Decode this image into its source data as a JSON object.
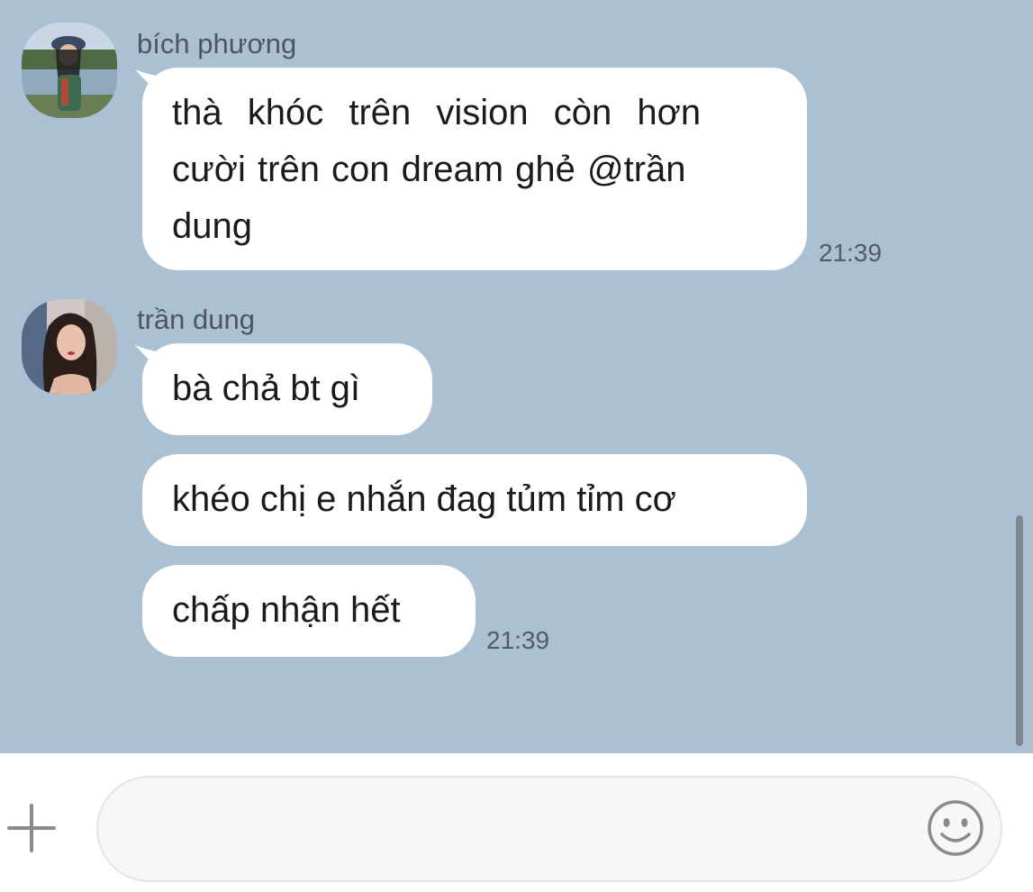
{
  "messages": [
    {
      "sender": "bích phương",
      "avatar": "avatar-bich-phuong",
      "bubbles": [
        {
          "lines": [
            "thà khóc trên vision còn hơn",
            "cười trên con dream ghẻ @trần",
            "dung"
          ]
        }
      ],
      "time": "21:39"
    },
    {
      "sender": "trần dung",
      "avatar": "avatar-tran-dung",
      "bubbles": [
        {
          "text": "bà chả bt gì"
        },
        {
          "text": "khéo chị e nhắn đag tủm tỉm cơ"
        },
        {
          "text": "chấp nhận hết"
        }
      ],
      "time": "21:39"
    }
  ],
  "composer": {
    "add_icon": "plus-icon",
    "emoji_icon": "smiley-icon",
    "placeholder": ""
  },
  "colors": {
    "chat_background": "#abc1d3",
    "bubble": "#ffffff",
    "input_background": "#f7f7f7",
    "icon": "#8a8a8a"
  }
}
